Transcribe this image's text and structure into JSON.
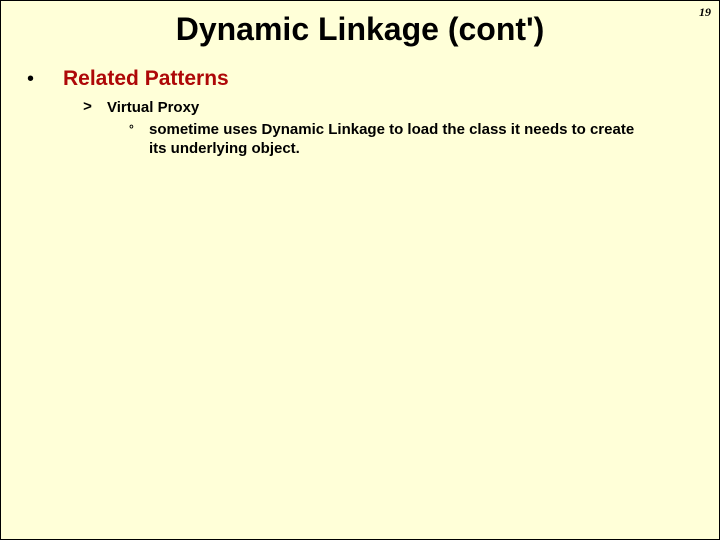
{
  "page_number": "19",
  "title": "Dynamic Linkage (cont')",
  "bullets": {
    "b1": {
      "marker": "•",
      "text": "Related Patterns"
    },
    "b2": {
      "marker": ">",
      "text": "Virtual Proxy"
    },
    "b3": {
      "marker": "°",
      "text": "sometime uses Dynamic Linkage to load the class it needs to create its underlying object."
    }
  }
}
